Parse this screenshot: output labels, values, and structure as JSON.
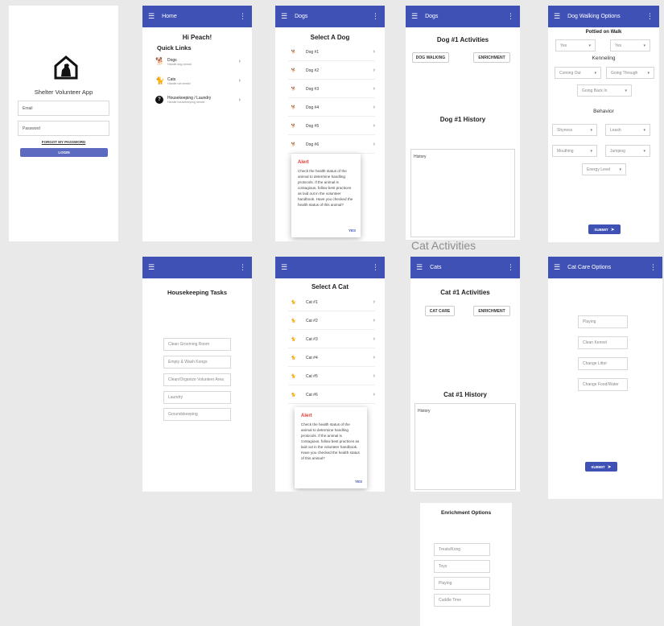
{
  "login": {
    "app_name": "Shelter Volunteer App",
    "email_placeholder": "Email",
    "password_placeholder": "Password",
    "forgot": "FORGOT MY PASSWORD",
    "login_btn": "LOGIN"
  },
  "home": {
    "bar_title": "Home",
    "greeting": "Hi Peach!",
    "quick_links": "Quick Links",
    "links": [
      {
        "title": "Dogs",
        "sub": "Handle dog needs!"
      },
      {
        "title": "Cats",
        "sub": "Handle cat needs!"
      },
      {
        "title": "Housekeeping / Laundry",
        "sub": "Handle housekeeping needs!"
      }
    ]
  },
  "dogs_list": {
    "bar_title": "Dogs",
    "heading": "Select A Dog",
    "items": [
      "Dog #1",
      "Dog #2",
      "Dog #3",
      "Dog #4",
      "Dog #5",
      "Dog #6"
    ]
  },
  "alert": {
    "title": "Alert",
    "body": "Check the health status of the animal to determine handling protocols.  If the animal is contagious, follow best practices as laid out in the volunteer handbook.  Have you checked the health status of this animal?",
    "yes": "YES"
  },
  "dog_activities": {
    "bar_title": "Dogs",
    "heading": "Dog #1 Activities",
    "btn1": "DOG WALKING",
    "btn2": "ENRICHMENT",
    "history_heading": "Dog #1 History",
    "history_placeholder": "History"
  },
  "dog_walking": {
    "bar_title": "Dog Walking Options",
    "potted": "Pottied on Walk",
    "potted_opts": [
      "Yes",
      "Yes"
    ],
    "kenneling": "Kenneling",
    "kennel_opts": [
      "Coming Out",
      "Going Through",
      "Going Back In"
    ],
    "behavior": "Behavior",
    "behavior_opts": [
      "Shyness",
      "Leash",
      "Mouthing",
      "Jumping",
      "Energy Level"
    ],
    "submit": "SUBMIT"
  },
  "cat_activities_caption": "Cat Activities",
  "housekeeping": {
    "heading": "Housekeeping Tasks",
    "tasks": [
      "Clean Grooming Room",
      "Empty & Wash Kongs",
      "Clean/Organize Volunteer Area",
      "Laundry",
      "Groundskeeping"
    ]
  },
  "cats_list": {
    "heading": "Select A Cat",
    "items": [
      "Cat #1",
      "Cat #2",
      "Cat #3",
      "Cat #4",
      "Cat #5",
      "Cat #6"
    ]
  },
  "cat_activities": {
    "bar_title": "Cats",
    "heading": "Cat #1 Activities",
    "btn1": "CAT CARE",
    "btn2": "ENRICHMENT",
    "history_heading": "Cat #1 History",
    "history_placeholder": "History"
  },
  "cat_care": {
    "bar_title": "Cat Care Options",
    "options": [
      "Playing",
      "Clean Kennel",
      "Change Litter",
      "Change Food/Water"
    ],
    "submit": "SUBMIT"
  },
  "enrichment": {
    "heading": "Enrichment Options",
    "options": [
      "Treats/Kong",
      "Toys",
      "Playing",
      "Cuddle Time"
    ]
  },
  "colors": {
    "primary": "#3f51b5",
    "alert": "#e53935"
  }
}
